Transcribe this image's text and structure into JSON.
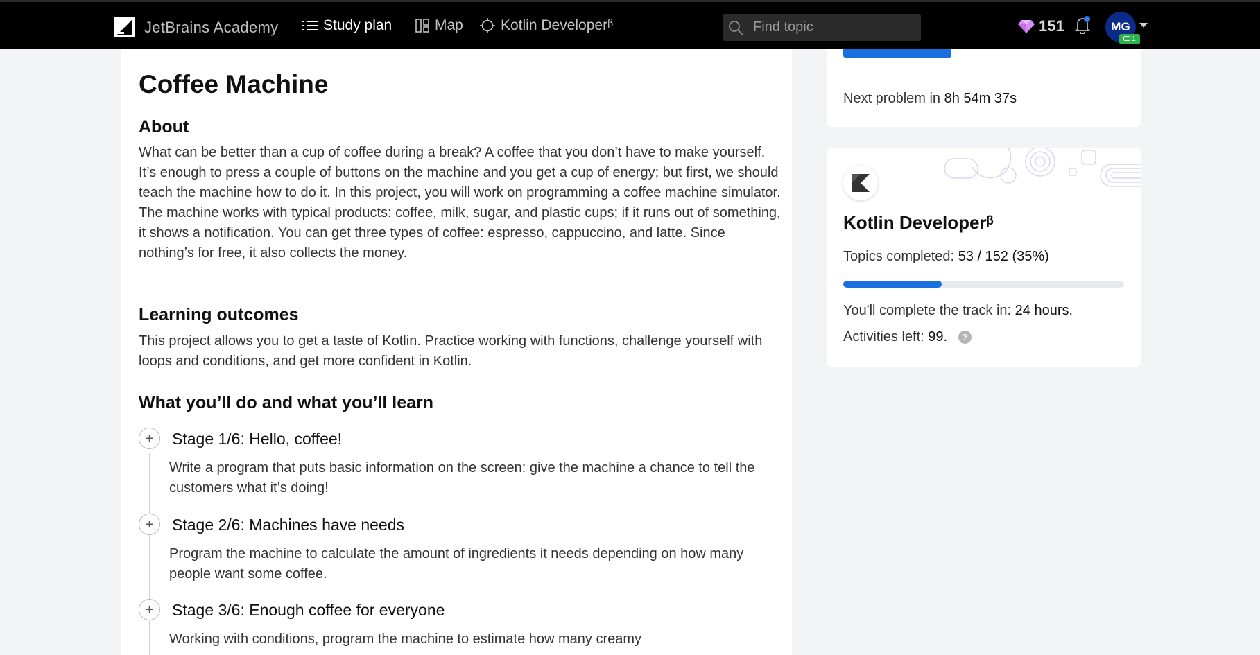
{
  "nav": {
    "brand": "JetBrains Academy",
    "items": [
      {
        "label": "Study plan",
        "icon": "list-icon",
        "active": true
      },
      {
        "label": "Map",
        "icon": "map-icon",
        "active": false
      },
      {
        "label": "Kotlin Developerᵝ",
        "icon": "track-icon",
        "active": false
      }
    ],
    "search_placeholder": "Find topic",
    "gems": "151",
    "avatar_initials": "MG",
    "avatar_badge": "1"
  },
  "project": {
    "title": "Coffee Machine",
    "about_heading": "About",
    "about_text": "What can be better than a cup of coffee during a break? A coffee that you don’t have to make yourself. It’s enough to press a couple of buttons on the machine and you get a cup of energy; but first, we should teach the machine how to do it. In this project, you will work on programming a coffee machine simulator. The machine works with typical products: coffee, milk, sugar, and plastic cups; if it runs out of something, it shows a notification. You can get three types of coffee: espresso, cappuccino, and latte. Since nothing’s for free, it also collects the money.",
    "outcomes_heading": "Learning outcomes",
    "outcomes_text": "This project allows you to get a taste of Kotlin. Practice working with functions, challenge yourself with loops and conditions, and get more confident in Kotlin.",
    "stages_heading": "What you’ll do and what you’ll learn",
    "stages": [
      {
        "title": "Stage 1/6: Hello, coffee!",
        "desc": "Write a program that puts basic information on the screen: give the machine a chance to tell the customers what it’s doing!"
      },
      {
        "title": "Stage 2/6: Machines have needs",
        "desc": "Program the machine to calculate the amount of ingredients it needs depending on how many people want some coffee."
      },
      {
        "title": "Stage 3/6: Enough coffee for everyone",
        "desc": "Working with conditions, program the machine to estimate how many creamy"
      }
    ]
  },
  "sidebar": {
    "next_problem_label": "Next problem in",
    "next_problem_time": "8h 54m 37s",
    "track_title": "Kotlin Developerᵝ",
    "topics_label": "Topics completed:",
    "topics_value": "53 / 152 (35%)",
    "progress_fraction": 0.35,
    "complete_label": "You'll complete the track in:",
    "complete_value": "24 hours.",
    "activities_label": "Activities left:",
    "activities_value": "99.",
    "help_glyph": "?"
  },
  "colors": {
    "accent": "#1a6fe0",
    "navbar": "#000000",
    "background": "#f3f4f6",
    "badge_green": "#2db34a",
    "gem": "#d88cf5"
  }
}
